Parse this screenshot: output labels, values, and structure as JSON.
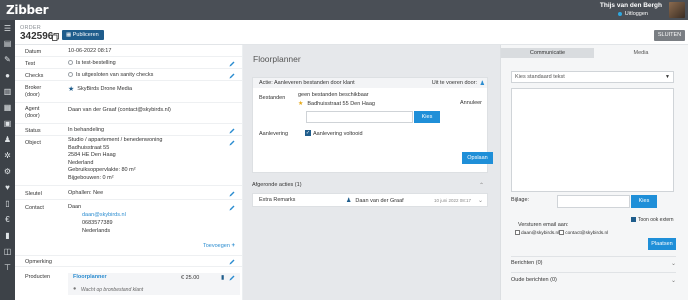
{
  "app": {
    "logo": "Zibber"
  },
  "user": {
    "name": "Thijs van den Bergh",
    "logout": "Uitloggen"
  },
  "header": {
    "order_label": "ORDER",
    "order_number": "342596",
    "publish_label": "Publiceren",
    "close_label": "SLUITEN"
  },
  "details": {
    "datum": {
      "label": "Datum",
      "value": "10-06-2022 08:17"
    },
    "test": {
      "label": "Test",
      "value": "Is test-bestelling"
    },
    "checks": {
      "label": "Checks",
      "value": "Is uitgesloten van sanity checks"
    },
    "broker": {
      "label": "Broker",
      "label2": "(door)",
      "value": "SkyBirds Drone Media"
    },
    "agent": {
      "label": "Agent",
      "label2": "(door)",
      "value": "Daan van der Graaf (contact@skybirds.nl)"
    },
    "status": {
      "label": "Status",
      "value": "In behandeling"
    },
    "object": {
      "label": "Object",
      "lines": [
        "Studio / appartement / benedenwoning",
        "Badhuisstraat 55",
        "2584 HE Den Haag",
        "Nederland",
        "Gebruiksoppervlakte: 80 m²",
        "Bijgebouwen: 0 m²"
      ]
    },
    "sleutel": {
      "label": "Sleutel",
      "value": "Ophallen: Nee"
    },
    "contact": {
      "label": "Contact",
      "name": "Daan",
      "email": "daan@skybirds.nl",
      "phone": "0683577389",
      "country": "Nederlands"
    },
    "toevoegen": "Toevoegen",
    "opmerking": {
      "label": "Opmerking"
    },
    "producten": {
      "label": "Producten",
      "name": "Floorplanner",
      "price": "€ 25.00",
      "note": "Wacht op bronbestand klant"
    }
  },
  "floorplanner": {
    "title": "Floorplanner",
    "action_title": "Actie: Aanleveren bestanden door klant",
    "action_owner": "Uit te voeren door:",
    "bestanden_label": "Bestanden",
    "bestanden_value": "geen bestanden beschikbaar",
    "address": "Badhuisstraat 55 Den Haag",
    "annuleer": "Annuleer",
    "kies": "Kies",
    "aanlevering_label": "Aanlevering",
    "aanlevering_value": "Aanlevering voltooid",
    "opslaan": "Opslaan",
    "afgeronde": "Afgeronde acties (1)",
    "extra_label": "Extra Remarks",
    "extra_person": "Daan van der Graaf",
    "extra_date": "10 juni 2022 08:17"
  },
  "communicatie": {
    "tab_active": "Communicatie",
    "tab_inactive": "Media",
    "std_text": "Kies standaard tekst",
    "bijlage": "Bijlage:",
    "kies": "Kies",
    "toon_extern": "Toon ook extern",
    "versturen": "Versturen email aan:",
    "email1": "daan@skybirds.nl",
    "email2": "contact@skybirds.nl",
    "plaatsen": "Plaatsen",
    "berichten": "Berichten (0)",
    "oude": "Oude berichten (0)"
  },
  "colors": {
    "topbar": "#4a4f56",
    "rail": "#3d4248",
    "accent": "#1f8fd8",
    "dark_blue": "#1f5d8c",
    "link": "#2a8cd0"
  }
}
